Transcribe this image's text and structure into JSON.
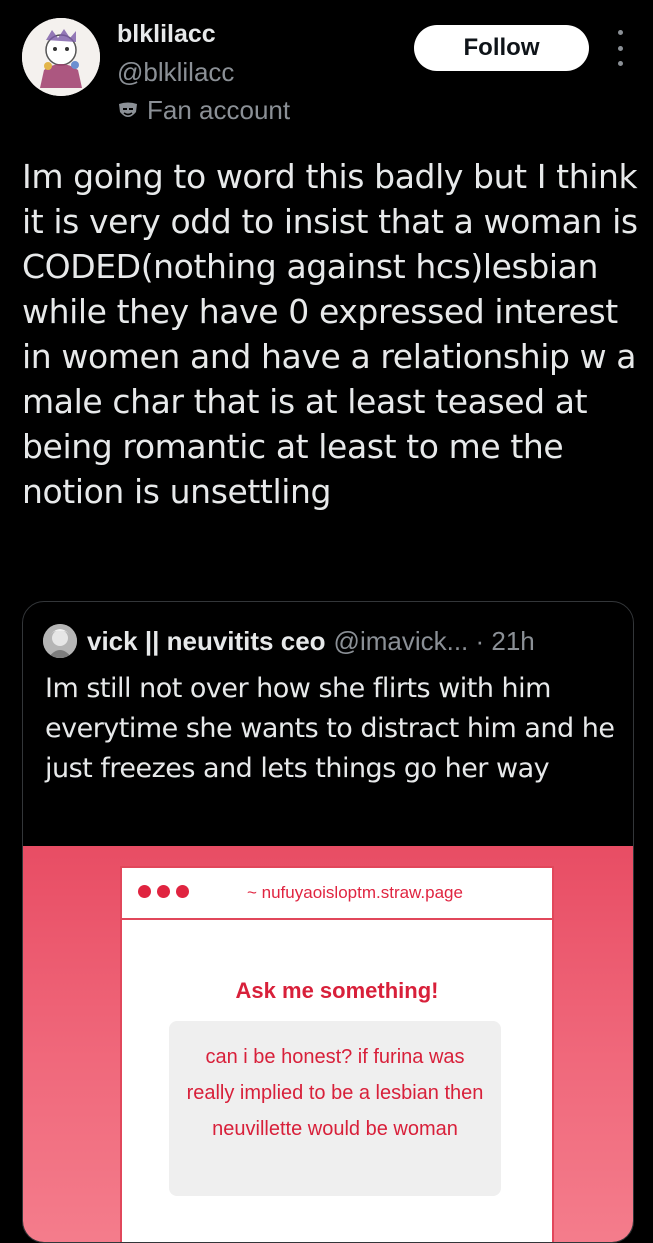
{
  "user": {
    "display_name": "blklilacc",
    "handle": "@blklilacc",
    "badge": "Fan account"
  },
  "follow_label": "Follow",
  "tweet_text": "Im going to word this badly but I think it is very odd to insist that a woman is CODED(nothing against hcs)lesbian while they have 0 expressed interest in women and have a relationship w a male char that is at least teased at being romantic at least to me the notion is unsettling",
  "quote": {
    "name": "vick || neuvitits ceo",
    "handle_time": "@imavick... · 21h",
    "text": "Im still not over how she flirts with him everytime she wants to distract him and he just freezes and lets things go her way"
  },
  "quote_image": {
    "url": "~ nufuyaoisloptm.straw.page",
    "heading": "Ask me something!",
    "message": "can i be honest? if furina was really implied to be a lesbian then neuvillette would be woman"
  },
  "colors": {
    "accent_red": "#e02440",
    "background": "#000000",
    "muted": "#8b9096"
  }
}
